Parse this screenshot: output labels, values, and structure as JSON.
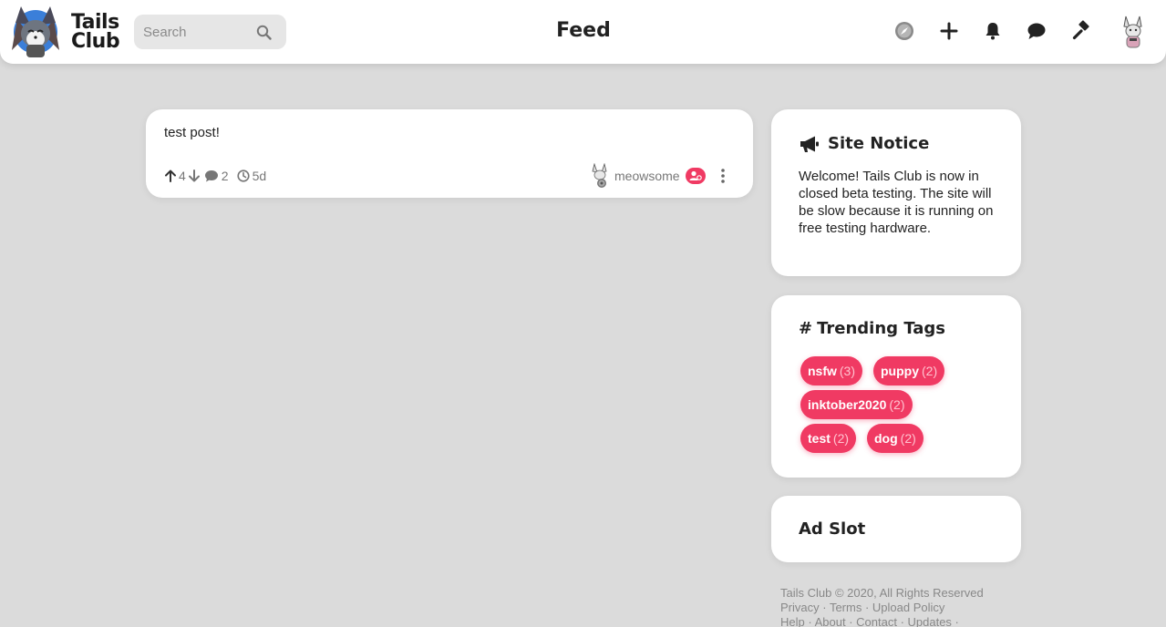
{
  "header": {
    "logo_line1": "Tails",
    "logo_line2": "Club",
    "search_placeholder": "Search",
    "title": "Feed",
    "nav_icons": [
      "compass-icon",
      "plus-icon",
      "bell-icon",
      "chat-icon",
      "gavel-icon",
      "avatar"
    ]
  },
  "post": {
    "text": "test post!",
    "upvotes": "4",
    "comments": "2",
    "age": "5d",
    "author": "meowsome"
  },
  "site_notice": {
    "title": "Site Notice",
    "body": "Welcome! Tails Club is now in closed beta testing. The site will be slow because it is running on free testing hardware."
  },
  "trending": {
    "title": "Trending Tags",
    "tags": [
      {
        "name": "nsfw",
        "count": "(3)"
      },
      {
        "name": "puppy",
        "count": "(2)"
      },
      {
        "name": "inktober2020",
        "count": "(2)"
      },
      {
        "name": "test",
        "count": "(2)"
      },
      {
        "name": "dog",
        "count": "(2)"
      }
    ]
  },
  "ad": {
    "title": "Ad Slot"
  },
  "footer": {
    "copyright": "Tails Club © 2020, All Rights Reserved",
    "links_row1": [
      "Privacy",
      "Terms",
      "Upload Policy"
    ],
    "links_row2": [
      "Help",
      "About",
      "Contact",
      "Updates"
    ]
  },
  "colors": {
    "accent": "#f03a63",
    "background": "#dbdbdb",
    "card": "#ffffff"
  }
}
